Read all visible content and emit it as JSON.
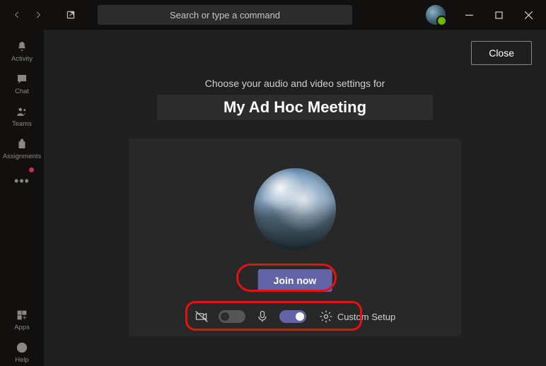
{
  "titlebar": {
    "search_placeholder": "Search or type a command"
  },
  "rail": {
    "items": [
      {
        "id": "activity",
        "label": "Activity"
      },
      {
        "id": "chat",
        "label": "Chat"
      },
      {
        "id": "teams",
        "label": "Teams"
      },
      {
        "id": "assignments",
        "label": "Assignments"
      }
    ],
    "bottom": [
      {
        "id": "apps",
        "label": "Apps"
      },
      {
        "id": "help",
        "label": "Help"
      }
    ]
  },
  "stage": {
    "close_label": "Close",
    "prompt": "Choose your audio and video settings for",
    "meeting_title": "My Ad Hoc Meeting",
    "join_label": "Join now",
    "custom_setup_label": "Custom Setup",
    "toggles": {
      "camera_on": false,
      "mic_on": true
    }
  }
}
